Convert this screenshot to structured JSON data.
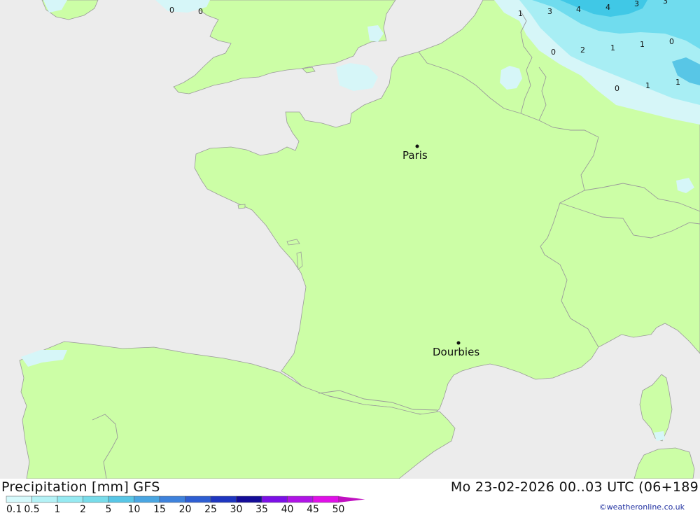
{
  "map": {
    "cities": [
      {
        "name": "Paris",
        "id": "paris"
      },
      {
        "name": "Dourbies",
        "id": "dourbies"
      }
    ],
    "contour_labels": [
      "0",
      "0",
      "1",
      "3",
      "4",
      "4",
      "3",
      "3",
      "0",
      "2",
      "1",
      "1",
      "0",
      "0",
      "1",
      "1"
    ],
    "colors": {
      "sea": "#ececec",
      "land": "#ccfea6",
      "border": "#9a9a9a",
      "precip_light": "#d6f6f8",
      "precip_mid": "#a8eef4",
      "precip_heavy": "#70dcee",
      "precip_core": "#40c8e6"
    }
  },
  "footer": {
    "title": "Precipitation [mm] GFS",
    "time": "Mo 23-02-2026 00..03 UTC (06+189",
    "credit": "©weatheronline.co.uk"
  },
  "legend": {
    "labels": [
      "0.1",
      "0.5",
      "1",
      "2",
      "5",
      "10",
      "15",
      "20",
      "25",
      "30",
      "35",
      "40",
      "45",
      "50"
    ],
    "colors": [
      "#d6fafc",
      "#b4f2f6",
      "#96eaf2",
      "#78dcea",
      "#58c6e6",
      "#4aa6e2",
      "#3e82dc",
      "#2e5ed2",
      "#1e36c0",
      "#140c98",
      "#7c10e6",
      "#b014e6",
      "#e010e8",
      "#c010c0"
    ]
  }
}
